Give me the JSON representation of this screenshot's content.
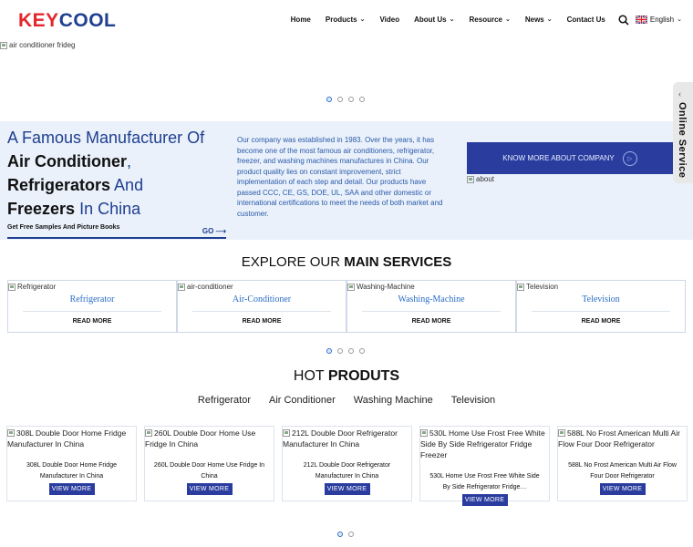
{
  "brand": {
    "part1": "KEY",
    "part2": "COOL"
  },
  "nav": {
    "items": [
      {
        "label": "Home",
        "dropdown": false
      },
      {
        "label": "Products",
        "dropdown": true
      },
      {
        "label": "Video",
        "dropdown": false
      },
      {
        "label": "About Us",
        "dropdown": true
      },
      {
        "label": "Resource",
        "dropdown": true
      },
      {
        "label": "News",
        "dropdown": true
      },
      {
        "label": "Contact Us",
        "dropdown": false
      }
    ],
    "language": "English"
  },
  "hero": {
    "image_alt": "air conditioner frideg"
  },
  "side_tab": {
    "label": "Online Service"
  },
  "intro": {
    "title_line1": "A Famous Manufacturer Of",
    "title_bold1": "Air Conditioner",
    "title_comma": ",",
    "title_bold2": "Refrigerators",
    "title_and": " And",
    "title_bold3": "Freezers",
    "title_tail": " In China",
    "samples_label": "Get Free Samples And Picture Books",
    "go_label": "GO",
    "description": "Our company was established in 1983. Over the years, it has become one of the most famous air conditioners, refrigerator, freezer, and washing machines manufactures in China. Our product quality lies on constant improvement, strict implementation of each step and detail. Our products have passed CCC, CE, GS, DOE, UL, SAA and other domestic or international certifications to meet the needs of both market and customer.",
    "know_more_label": "KNOW MORE ABOUT COMPANY",
    "about_alt": "about"
  },
  "services": {
    "title_plain": "EXPLORE OUR ",
    "title_bold": "MAIN SERVICES",
    "items": [
      {
        "alt": "Refrigerator",
        "name": "Refrigerator",
        "more": "READ MORE"
      },
      {
        "alt": "air-conditioner",
        "name": "Air-Conditioner",
        "more": "READ MORE"
      },
      {
        "alt": "Washing-Machine",
        "name": "Washing-Machine",
        "more": "READ MORE"
      },
      {
        "alt": "Television",
        "name": "Television",
        "more": "READ MORE"
      }
    ]
  },
  "hot": {
    "title_plain": "HOT ",
    "title_bold": "PRODUTS",
    "categories": [
      "Refrigerator",
      "Air Conditioner",
      "Washing Machine",
      "Television"
    ],
    "products": [
      {
        "alt": "308L Double Door Home Fridge Manufacturer In China",
        "name": "308L Double Door Home Fridge Manufacturer In China",
        "button": "VIEW MORE"
      },
      {
        "alt": "260L Double Door Home Use Fridge In China",
        "name": "260L Double Door Home Use Fridge In China",
        "button": "VIEW MORE"
      },
      {
        "alt": "212L Double Door Refrigerator Manufacturer In China",
        "name": "212L Double Door Refrigerator Manufacturer In China",
        "button": "VIEW MORE"
      },
      {
        "alt": "530L Home Use Frost Free White Side By Side Refrigerator Fridge Freezer",
        "name": "530L Home Use Frost Free White Side By Side Refrigerator Fridge…",
        "button": "VIEW MORE"
      },
      {
        "alt": "588L No Frost American Multi Air Flow Four Door Refrigerator",
        "name": "588L No Frost American Multi Air Flow Four Door Refrigerator",
        "button": "VIEW MORE"
      }
    ]
  },
  "colors": {
    "brand_red": "#e3262b",
    "brand_blue": "#1f3f8f",
    "accent_blue": "#2a6ec5",
    "button_blue": "#2a3d9e",
    "band_bg": "#eaf1fb"
  }
}
